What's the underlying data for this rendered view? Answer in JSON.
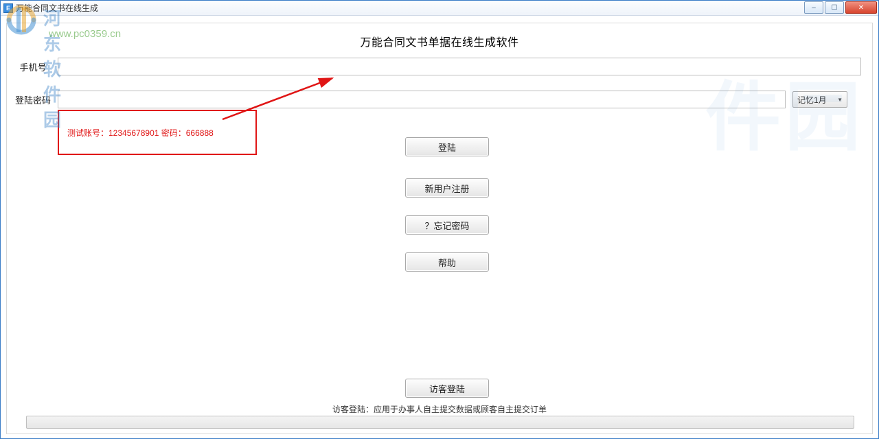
{
  "window": {
    "title": "万能合同文书在线生成",
    "controls": {
      "min": "–",
      "max": "☐",
      "close": "✕"
    }
  },
  "watermark": {
    "brand": "河东软件园",
    "url": "www.pc0359.cn",
    "faded": "件园"
  },
  "heading": "万能合同文书单据在线生成软件",
  "form": {
    "phone_label": "手机号",
    "phone_value": "",
    "password_label": "登陆密码",
    "password_value": "",
    "remember_selected": "记忆1月"
  },
  "test_credentials": "测试账号：12345678901  密码：666888",
  "buttons": {
    "login": "登陆",
    "register": "新用户注册",
    "forgot": "？忘记密码",
    "help": "帮助",
    "guest": "访客登陆"
  },
  "footer_note": "访客登陆：应用于办事人自主提交数据或顾客自主提交订单"
}
